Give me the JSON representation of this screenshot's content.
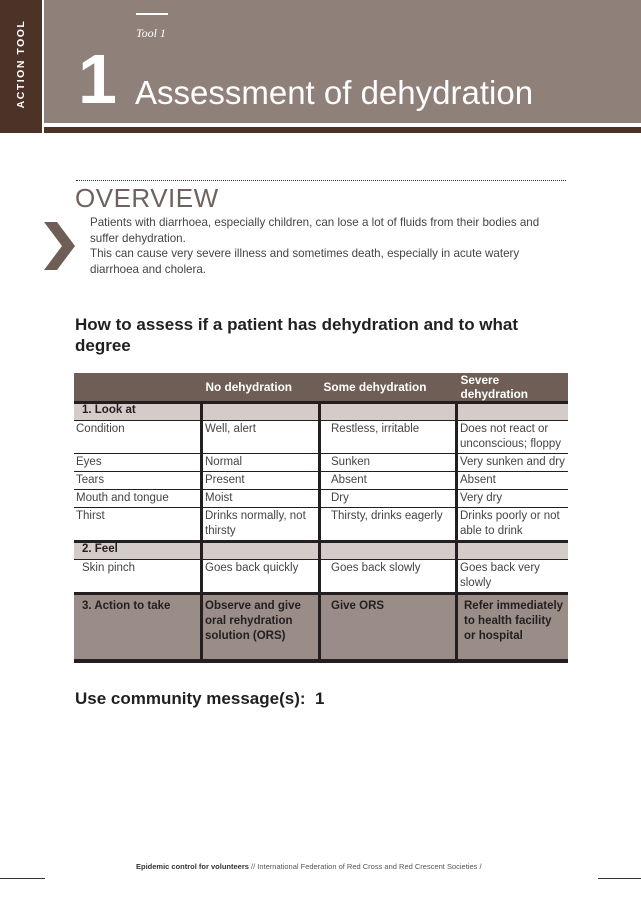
{
  "side_tab": {
    "label": "ACTION TOOL"
  },
  "header": {
    "tool_label": "Tool 1",
    "tool_number": "1",
    "title": "Assessment of dehydration"
  },
  "overview": {
    "title": "OVERVIEW",
    "paragraphs": [
      "Patients with diarrhoea, especially children, can lose a lot of fluids from their bodies and suffer dehydration.",
      "This can cause very severe illness and sometimes death, especially in acute watery diarrhoea and cholera."
    ]
  },
  "section_heading": "How to assess if a patient has dehydration and to what degree",
  "table": {
    "headers": [
      "",
      "No dehydration",
      "Some dehydration",
      "Severe dehydration"
    ],
    "look_at": {
      "label": "1. Look at",
      "rows": [
        [
          "Condition",
          "Well, alert",
          "Restless, irritable",
          "Does not react or unconscious; floppy"
        ],
        [
          "Eyes",
          "Normal",
          "Sunken",
          "Very sunken and dry"
        ],
        [
          "Tears",
          "Present",
          "Absent",
          "Absent"
        ],
        [
          "Mouth and tongue",
          "Moist",
          "Dry",
          "Very dry"
        ],
        [
          "Thirst",
          "Drinks normally, not thirsty",
          "Thirsty, drinks eagerly",
          "Drinks poorly or not able to drink"
        ]
      ]
    },
    "feel": {
      "label": "2. Feel",
      "rows": [
        [
          "Skin pinch",
          "Goes back quickly",
          "Goes back slowly",
          "Goes back very slowly"
        ]
      ]
    },
    "action": [
      "3. Action to take",
      "Observe and give oral rehydration solution (ORS)",
      "Give ORS",
      "Refer immediately to health facility or hospital"
    ]
  },
  "community_message": "Use community message(s):  1",
  "footer": {
    "bold": "Epidemic control for volunteers",
    "rest": " // International Federation of Red Cross and Red Crescent Societies /"
  },
  "colors": {
    "dark_brown": "#4d3327",
    "header_taupe": "#8f8079",
    "table_header": "#6f5e55",
    "section_row": "#d3ccc8",
    "action_row": "#9a8c86"
  }
}
